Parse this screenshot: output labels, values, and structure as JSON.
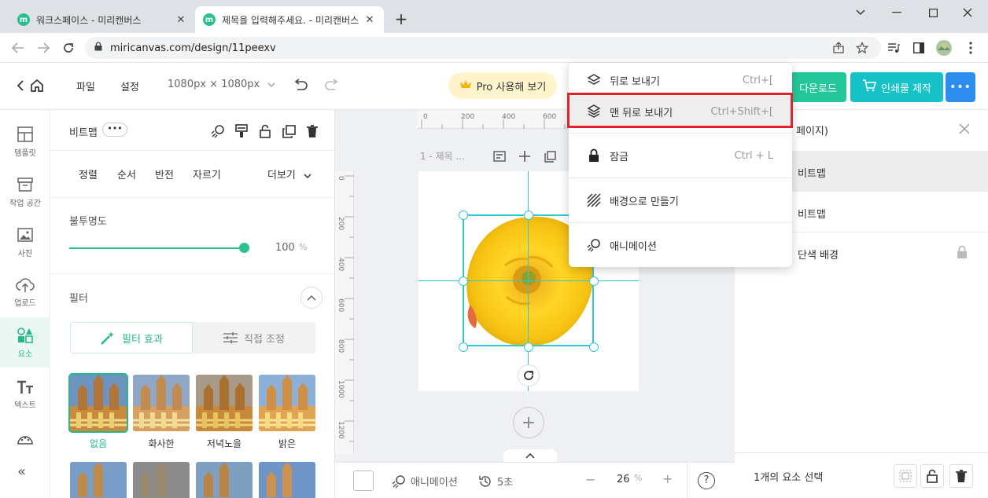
{
  "browser": {
    "tabs": [
      {
        "title": "워크스페이스 - 미리캔버스",
        "favicon": "m"
      },
      {
        "title": "제목을 입력해주세요. - 미리캔버스",
        "favicon": "m"
      }
    ],
    "new_tab": "+",
    "url": "miricanvas.com/design/11peexv"
  },
  "header": {
    "file_menu": "파일",
    "settings_menu": "설정",
    "canvas_size": "1080px × 1080px",
    "pro_button": "Pro 사용해 보기",
    "download_button": "다운로드",
    "print_button": "인쇄물 제작",
    "more_button": "•••"
  },
  "rail": {
    "items": [
      {
        "label": "템플릿",
        "icon": "template-icon"
      },
      {
        "label": "작업 공간",
        "icon": "workspace-icon"
      },
      {
        "label": "사진",
        "icon": "photo-icon"
      },
      {
        "label": "업로드",
        "icon": "upload-icon"
      },
      {
        "label": "요소",
        "icon": "elements-icon"
      },
      {
        "label": "텍스트",
        "icon": "text-icon"
      },
      {
        "label": "",
        "icon": "palette-icon"
      }
    ],
    "collapse": "«"
  },
  "props": {
    "element_name": "비트맵",
    "dots": "•••",
    "subtabs": [
      "정렬",
      "순서",
      "반전",
      "자르기"
    ],
    "more": "더보기",
    "opacity_label": "불투명도",
    "opacity_value": "100",
    "opacity_unit": "%",
    "opacity_level": 1.0,
    "filter_label": "필터",
    "filter_tabs": [
      "필터 효과",
      "직접 조정"
    ],
    "filters": [
      "없음",
      "화사한",
      "저녁노을",
      "밝은"
    ]
  },
  "canvas": {
    "ruler_top": [
      "0",
      "200",
      "400",
      "600"
    ],
    "ruler_left": [
      "0",
      "200",
      "400",
      "600",
      "800",
      "1000",
      "1200"
    ],
    "page_title": "1 - 제목 ...",
    "add_page": "+"
  },
  "bottombar": {
    "animation": "애니메이션",
    "duration": "5초",
    "zoom_minus": "−",
    "zoom": "26",
    "zoom_unit": "%",
    "zoom_plus": "+",
    "help": "?"
  },
  "layers": {
    "title": "페이지)",
    "rows": [
      {
        "label": "비트맵",
        "selected": true
      },
      {
        "label": "비트맵",
        "selected": false
      },
      {
        "label": "단색 배경",
        "selected": false,
        "locked": true
      }
    ],
    "footer_text": "1개의 요소 선택"
  },
  "context_menu": {
    "items": [
      {
        "label": "뒤로 보내기",
        "shortcut": "Ctrl+[",
        "icon": "send-backward-icon"
      },
      {
        "label": "맨 뒤로 보내기",
        "shortcut": "Ctrl+Shift+[",
        "icon": "send-to-back-icon",
        "highlighted": true
      },
      {
        "label": "잠금",
        "shortcut": "Ctrl + L",
        "icon": "lock-icon"
      },
      {
        "label": "배경으로 만들기",
        "shortcut": "",
        "icon": "make-background-icon"
      },
      {
        "label": "애니메이션",
        "shortcut": "",
        "icon": "animation-icon"
      }
    ]
  },
  "colors": {
    "accent": "#24c79a",
    "print": "#16c2c5",
    "more": "#2e8ef0",
    "guide": "#31c9d5",
    "highlight": "#e0242a"
  }
}
